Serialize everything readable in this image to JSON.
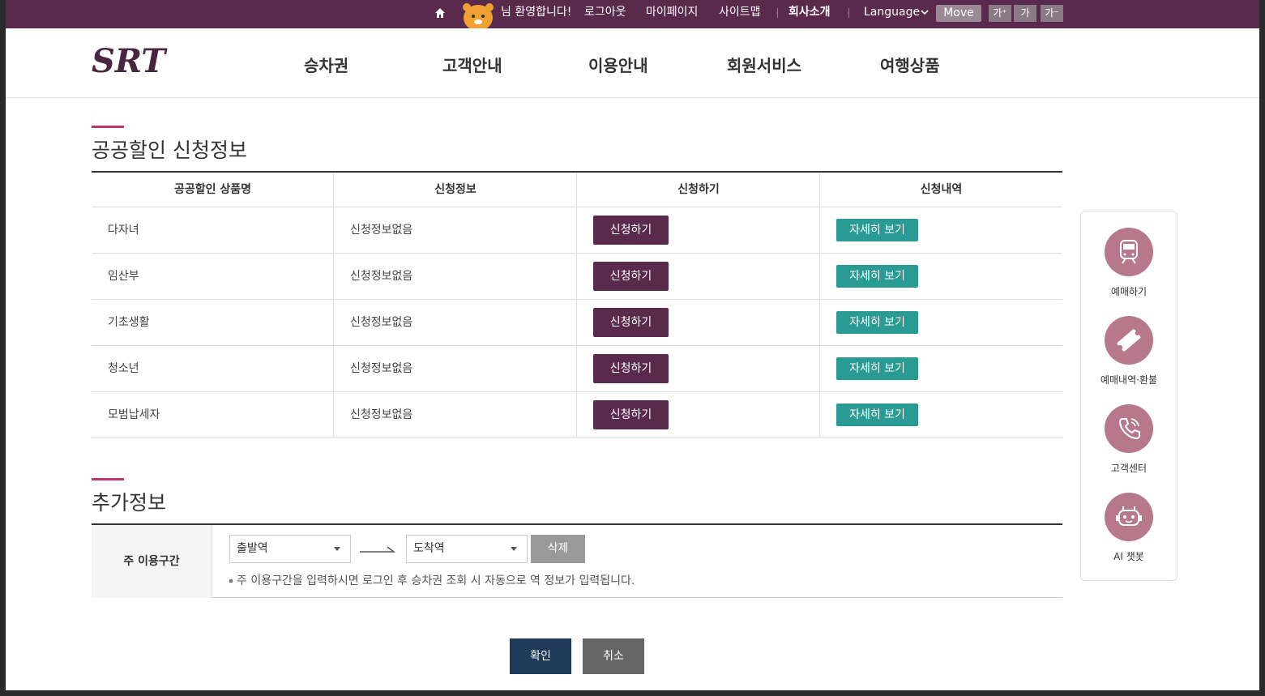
{
  "topbar": {
    "welcome": "님 환영합니다!",
    "logout": "로그아웃",
    "mypage": "마이페이지",
    "sitemap": "사이트맵",
    "company": "회사소개",
    "language": "Language",
    "move": "Move",
    "font_up": "가⁺",
    "font_normal": "가",
    "font_down": "가⁻"
  },
  "header": {
    "logo_text": "SRT",
    "nav": [
      "승차권",
      "고객안내",
      "이용안내",
      "회원서비스",
      "여행상품"
    ]
  },
  "discount": {
    "title": "공공할인 신청정보",
    "headers": [
      "공공할인 상품명",
      "신청정보",
      "신청하기",
      "신청내역"
    ],
    "rows": [
      {
        "name": "다자녀",
        "info": "신청정보없음",
        "apply": "신청하기",
        "detail": "자세히 보기"
      },
      {
        "name": "임산부",
        "info": "신청정보없음",
        "apply": "신청하기",
        "detail": "자세히 보기"
      },
      {
        "name": "기초생활",
        "info": "신청정보없음",
        "apply": "신청하기",
        "detail": "자세히 보기"
      },
      {
        "name": "청소년",
        "info": "신청정보없음",
        "apply": "신청하기",
        "detail": "자세히 보기"
      },
      {
        "name": "모범납세자",
        "info": "신청정보없음",
        "apply": "신청하기",
        "detail": "자세히 보기"
      }
    ]
  },
  "extra": {
    "title": "추가정보",
    "label": "주 이용구간",
    "departure": "출발역",
    "arrival": "도착역",
    "delete": "삭제",
    "note": "주 이용구간을 입력하시면 로그인 후 승차권 조회 시 자동으로 역 정보가 입력됩니다."
  },
  "buttons": {
    "ok": "확인",
    "cancel": "취소"
  },
  "quick": {
    "items": [
      "예매하기",
      "예매내역·환불",
      "고객센터",
      "AI 챗봇"
    ]
  },
  "colors": {
    "brand": "#5a2a4c",
    "accent": "#c0356e",
    "teal": "#2a9a94",
    "quick_icon": "#b7788c",
    "ok": "#203a5a"
  }
}
